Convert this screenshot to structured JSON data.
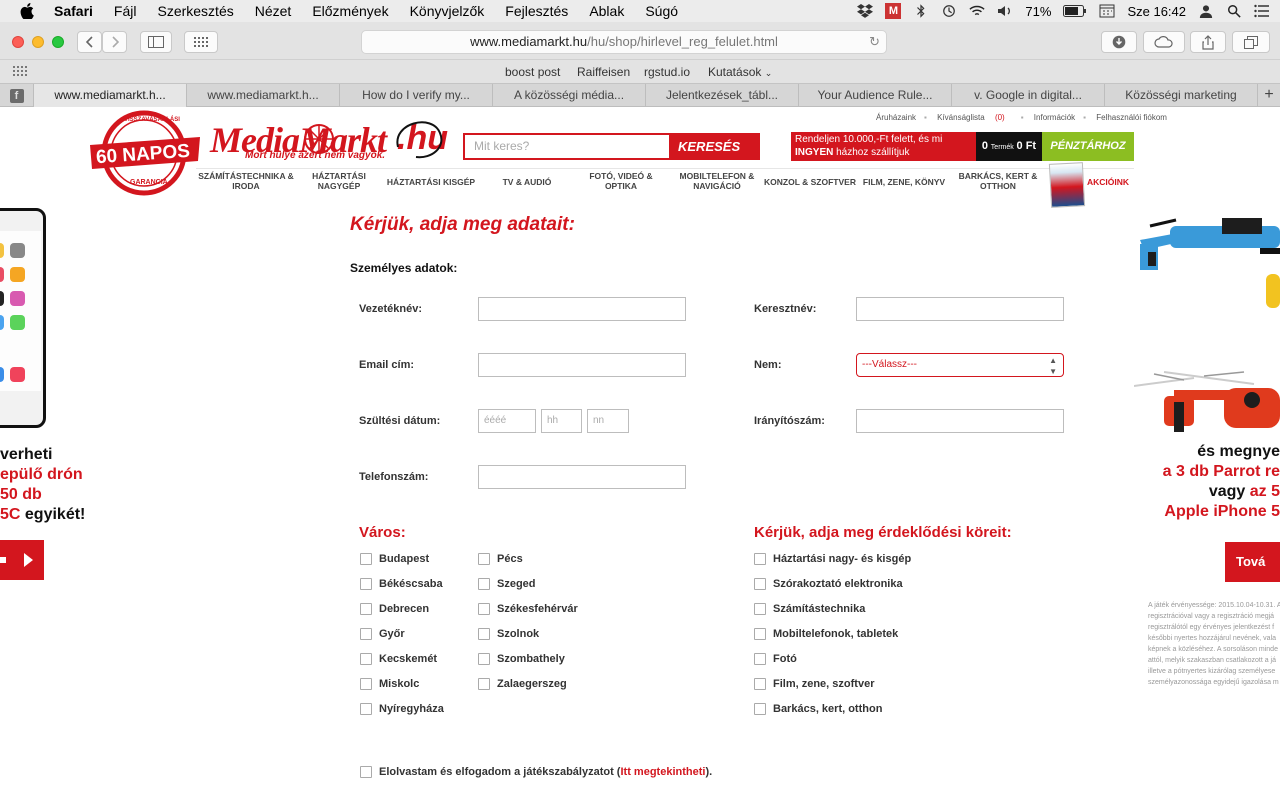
{
  "menubar": {
    "app": "Safari",
    "items": [
      "Fájl",
      "Szerkesztés",
      "Nézet",
      "Előzmények",
      "Könyvjelzők",
      "Fejlesztés",
      "Ablak",
      "Súgó"
    ],
    "battery": "71%",
    "clock": "Sze 16:42",
    "gmail_badge": "M"
  },
  "toolbar": {
    "url_domain": "www.mediamarkt.hu",
    "url_path": "/hu/shop/hirlevel_reg_felulet.html"
  },
  "favorites": [
    "boost post",
    "Raiffeisen",
    "rgstud.io",
    "Kutatások"
  ],
  "tabs": [
    "www.mediamarkt.h...",
    "www.mediamarkt.h...",
    "How do I verify my...",
    "A közösségi média...",
    "Jelentkezések_tábl...",
    "Your Audience Rule...",
    "v. Google in digital...",
    "Közösségi marketing"
  ],
  "header": {
    "badge_top": "VISSZAVÁSÁRLÁSI",
    "badge_main": "60 NAPOS",
    "badge_bottom": "GARANCIA",
    "logo": "MediaMarkt",
    "logo_tld": ".hu",
    "slogan": "Mort hülye azért nem vagyok.",
    "search_placeholder": "Mit keres?",
    "search_button": "KERESÉS",
    "toplinks": {
      "stores": "Áruházaink",
      "wishlist": "Kívánságlista",
      "wishlist_count": "(0)",
      "info": "Információk",
      "account": "Felhasználói fiókom"
    },
    "shipping_line1": "Rendeljen 10.000,-Ft felett, és mi",
    "shipping_free": "INGYEN",
    "shipping_line2": "házhoz szállítjuk",
    "cart_count": "0",
    "cart_label": "Termék",
    "cart_total": "0 Ft",
    "cash_button": "PÉNZTÁRHOZ"
  },
  "categories": [
    "SZÁMÍTÁSTECHNIKA & IRODA",
    "HÁZTARTÁSI NAGYGÉP",
    "HÁZTARTÁSI KISGÉP",
    "TV & AUDIÓ",
    "FOTÓ, VIDEÓ & OPTIKA",
    "MOBILTELEFON & NAVIGÁCIÓ",
    "KONZOL & SZOFTVER",
    "FILM, ZENE, KÖNYV",
    "BARKÁCS, KERT & OTTHON",
    "AKCIÓINK"
  ],
  "left_banner": {
    "line1": "verheti",
    "line2": "epülő drón",
    "line3": "50 db",
    "line4a": "5C",
    "line4b": " egyikét!"
  },
  "right_banner": {
    "line1a": "és ",
    "line1b": "megnye",
    "line2": "a 3 db Parrot re",
    "line3a": "vagy ",
    "line3b": "az 5",
    "line4": "Apple iPhone 5",
    "button": "Tová",
    "fineprint": [
      "A játék érvényessége: 2015.10.04-10.31. A",
      "regisztrációval vagy a regisztráció megjá",
      "regisztrálótól egy érvényes jelentkezést f",
      "későbbi nyertes hozzájárul nevének, vala",
      "képnek a közléséhez. A sorsoláson minde",
      "attól, melyik szakaszban csatlakozott a já",
      "illetve a pótnyertes kizárólag személyese",
      "személyazonossága egyidejű igazolása m"
    ]
  },
  "form": {
    "title": "Kérjük, adja meg adatait:",
    "personal": "Személyes adatok:",
    "last_name": "Vezetéknév:",
    "first_name": "Keresztnév:",
    "email": "Email cím:",
    "gender": "Nem:",
    "gender_value": "---Válassz---",
    "birth": "Szültési dátum:",
    "year_ph": "éééé",
    "month_ph": "hh",
    "day_ph": "nn",
    "zip": "Irányítószám:",
    "phone": "Telefonszám:",
    "city_title": "Város:",
    "interest_title": "Kérjük, adja meg érdeklődési köreit:",
    "cities_col1": [
      "Budapest",
      "Békéscsaba",
      "Debrecen",
      "Győr",
      "Kecskemét",
      "Miskolc",
      "Nyíregyháza"
    ],
    "cities_col2": [
      "Pécs",
      "Szeged",
      "Székesfehérvár",
      "Szolnok",
      "Szombathely",
      "Zalaegerszeg"
    ],
    "interests": [
      "Háztartási nagy- és kisgép",
      "Szórakoztató elektronika",
      "Számítástechnika",
      "Mobiltelefonok, tabletek",
      "Fotó",
      "Film, zene, szoftver",
      "Barkács, kert, otthon"
    ],
    "terms_before": "Elolvastam és elfogadom a játékszabályzatot (",
    "terms_link": "Itt megtekintheti",
    "terms_after": ")."
  },
  "colors": {
    "brand_red": "#d3161e",
    "cash_green": "#8cbe22"
  }
}
